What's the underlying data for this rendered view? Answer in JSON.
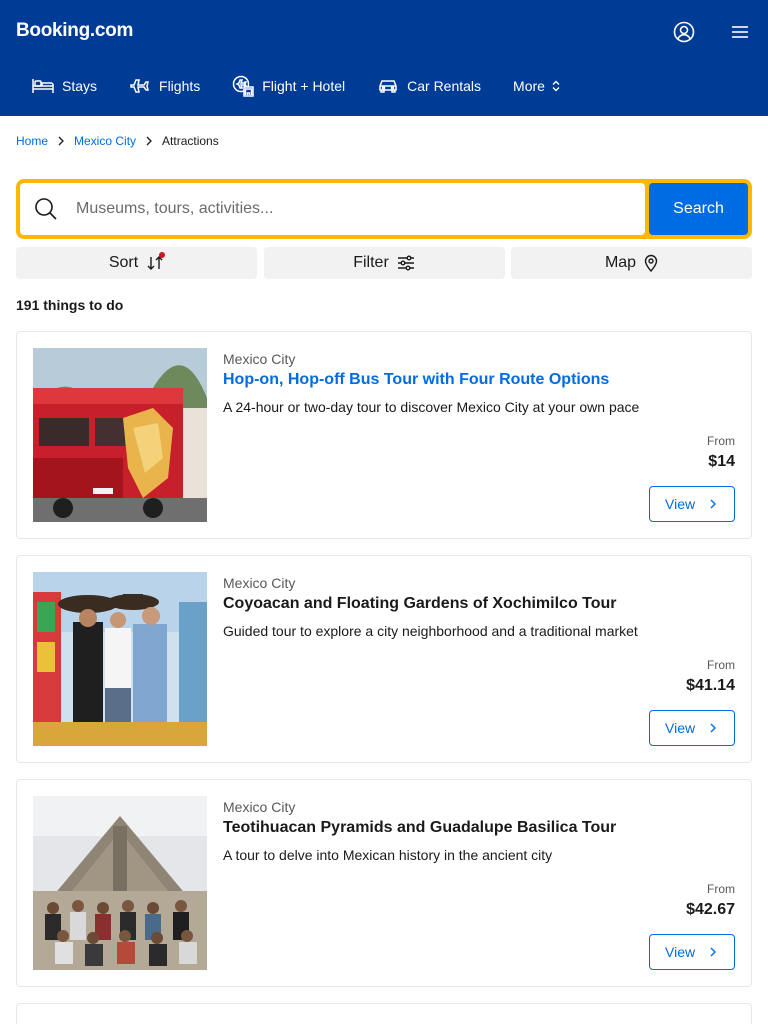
{
  "header": {
    "logo": "Booking.com",
    "nav": [
      {
        "label": "Stays",
        "icon": "bed-icon"
      },
      {
        "label": "Flights",
        "icon": "plane-icon"
      },
      {
        "label": "Flight + Hotel",
        "icon": "flight-hotel-icon"
      },
      {
        "label": "Car Rentals",
        "icon": "car-icon"
      },
      {
        "label": "More",
        "icon": "chevron-updown-icon"
      }
    ]
  },
  "breadcrumb": {
    "home": "Home",
    "city": "Mexico City",
    "current": "Attractions"
  },
  "search": {
    "placeholder": "Museums, tours, activities...",
    "button": "Search"
  },
  "tools": {
    "sort": "Sort",
    "filter": "Filter",
    "map": "Map"
  },
  "results_count": "191 things to do",
  "cards": [
    {
      "location": "Mexico City",
      "title": "Hop-on, Hop-off Bus Tour with Four Route Options",
      "description": "A 24-hour or two-day tour to discover Mexico City at your own pace",
      "from": "From",
      "price": "$14",
      "view": "View"
    },
    {
      "location": "Mexico City",
      "title": "Coyoacan and Floating Gardens of Xochimilco Tour",
      "description": "Guided tour to explore a city neighborhood and a traditional market",
      "from": "From",
      "price": "$41.14",
      "view": "View"
    },
    {
      "location": "Mexico City",
      "title": "Teotihuacan Pyramids and Guadalupe Basilica Tour",
      "description": "A tour to delve into Mexican history in the ancient city",
      "from": "From",
      "price": "$42.67",
      "view": "View"
    }
  ],
  "colors": {
    "header_bg": "#003b95",
    "brand_blue": "#006ce4",
    "search_border": "#ffb700",
    "notification_dot": "#d4111e"
  }
}
